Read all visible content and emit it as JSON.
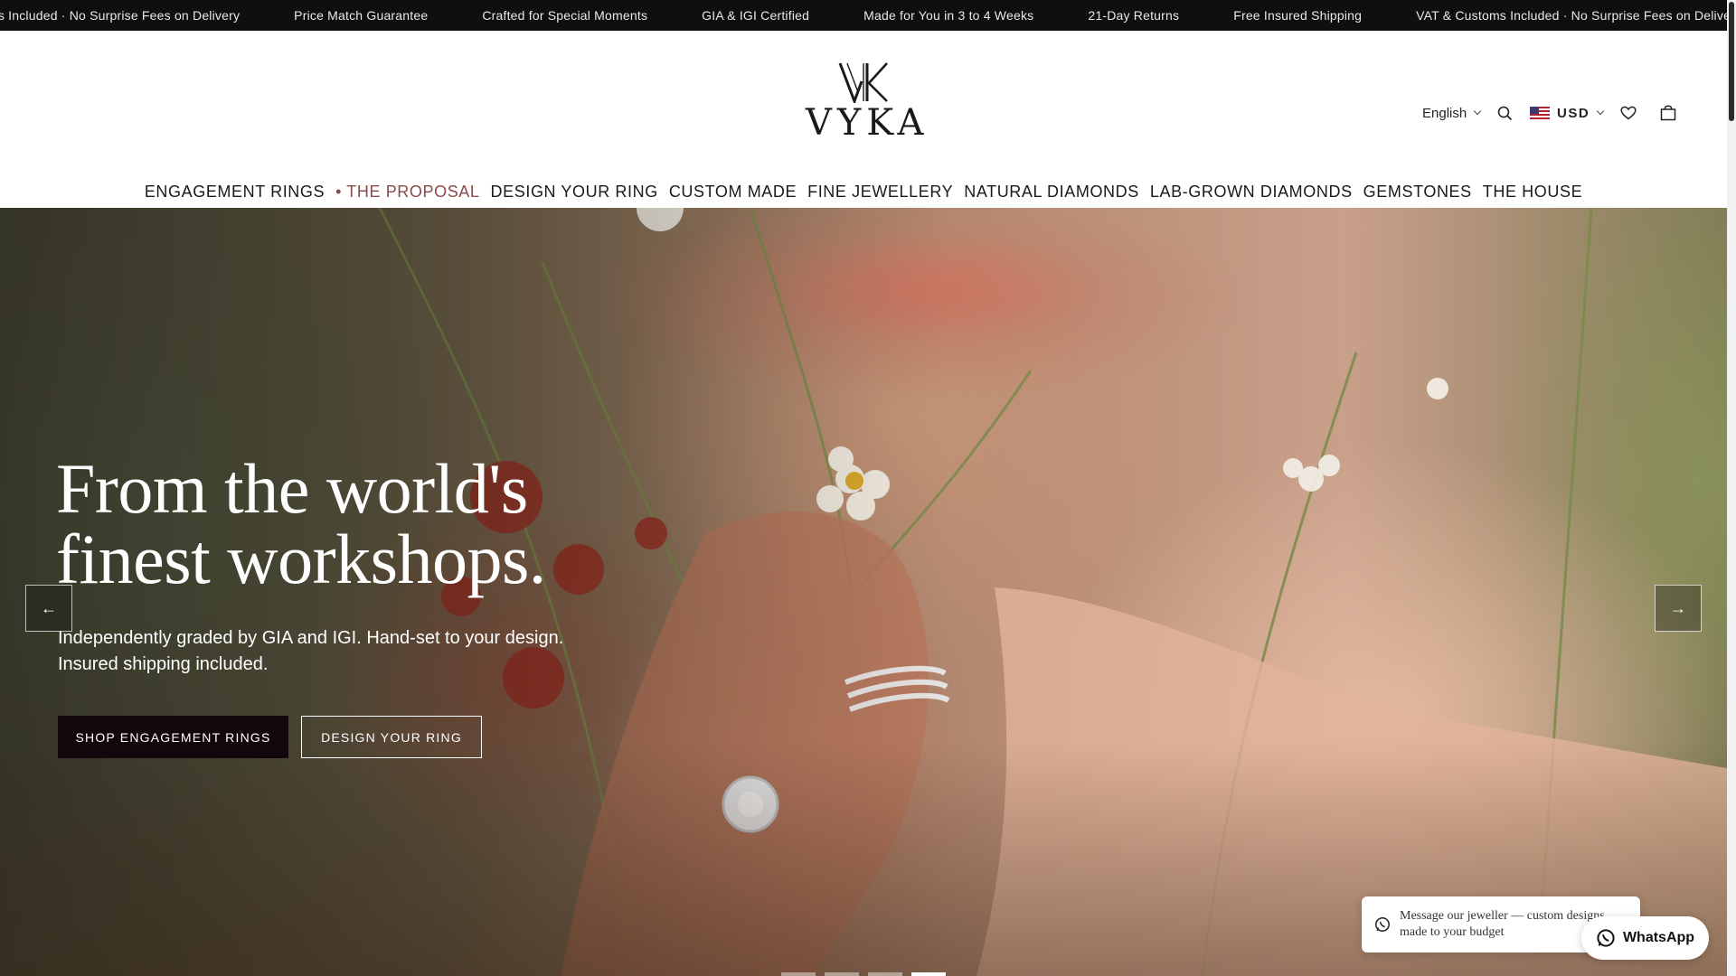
{
  "announcement": {
    "items": [
      "VAT & Customs Included · No Surprise Fees on Delivery",
      "Price Match Guarantee",
      "Crafted for Special Moments",
      "GIA & IGI Certified",
      "Made for You in 3 to 4 Weeks",
      "21-Day Returns",
      "Free Insured Shipping",
      "VAT & Customs Included · No Surprise Fees on Delivery"
    ],
    "first_visible": "ms Included · No Surprise Fees on Delivery"
  },
  "header": {
    "logo_text": "VYKA",
    "language": "English",
    "currency": "USD",
    "icons": [
      "search-icon",
      "us-flag-icon",
      "heart-icon",
      "bag-icon"
    ]
  },
  "nav": {
    "items": [
      {
        "label": "ENGAGEMENT RINGS"
      },
      {
        "label": "• THE PROPOSAL"
      },
      {
        "label": "DESIGN YOUR RING"
      },
      {
        "label": "CUSTOM MADE"
      },
      {
        "label": "FINE JEWELLERY"
      },
      {
        "label": "NATURAL DIAMONDS"
      },
      {
        "label": "LAB-GROWN DIAMONDS"
      },
      {
        "label": "GEMSTONES"
      },
      {
        "label": "THE HOUSE"
      }
    ],
    "accent_color": "#8a4b4b"
  },
  "hero": {
    "headline_line1": "From the world's",
    "headline_line2": "finest workshops.",
    "subcopy_line1": "Independently graded by GIA and IGI. Hand-set to your design.",
    "subcopy_line2": "Insured shipping included.",
    "primary_cta": "SHOP ENGAGEMENT RINGS",
    "secondary_cta": "DESIGN YOUR RING",
    "prev_arrow": "←",
    "next_arrow": "→",
    "slide_count": 4,
    "active_slide": 4
  },
  "chat": {
    "message": "Message our jeweller — custom designs, made to your budget",
    "button_label": "WhatsApp"
  },
  "colors": {
    "announcement_bg": "#0f0f0f",
    "primary_button_bg": "#14070b"
  }
}
